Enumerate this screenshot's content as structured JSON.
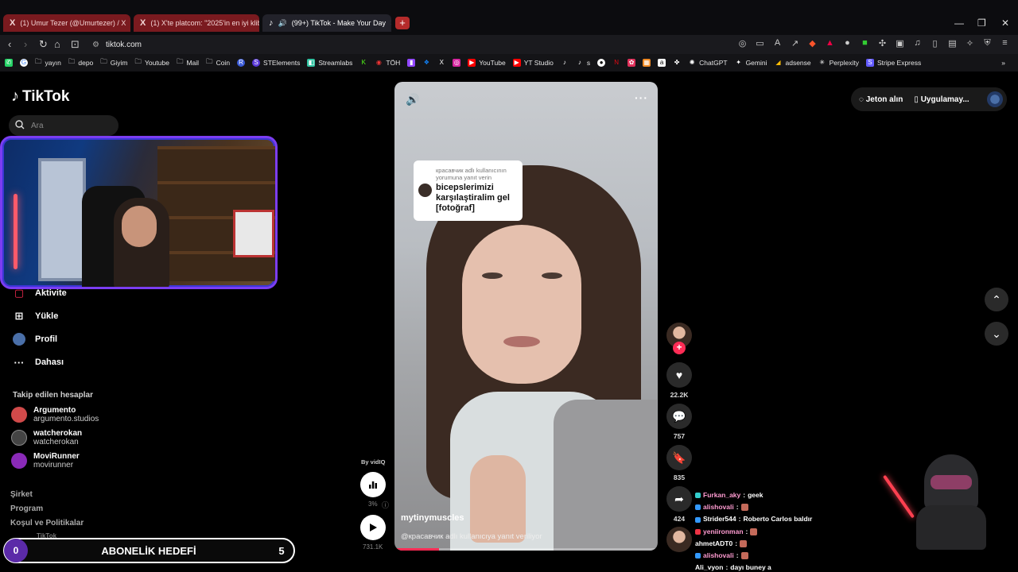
{
  "browser": {
    "tabs": [
      {
        "title": "(1) Umur Tezer (@Umurtezer) / X",
        "logo": "X"
      },
      {
        "title": "(1) X'te platcom: \"2025'in en iyi klibi",
        "logo": "X"
      },
      {
        "title": "(99+) TikTok - Make Your Day",
        "logo": "♪"
      }
    ],
    "new_tab": "+",
    "url": "tiktok.com",
    "bookmarks": [
      "yayın",
      "depo",
      "Giyim",
      "Youtube",
      "Mail",
      "Coin",
      "STElements",
      "Streamlabs",
      "TÖH",
      "YouTube",
      "YT Studio",
      "s",
      "ChatGPT",
      "Gemini",
      "adsense",
      "Perplexity",
      "Stripe Express"
    ]
  },
  "sidebar": {
    "brand": "TikTok",
    "search_placeholder": "Ara",
    "items": [
      {
        "label": "Aktivite"
      },
      {
        "label": "Yükle"
      },
      {
        "label": "Profil"
      },
      {
        "label": "Dahası"
      }
    ],
    "following_title": "Takip edilen hesaplar",
    "following": [
      {
        "name": "Argumento",
        "handle": "argumento.studios",
        "color": "#d04a4a"
      },
      {
        "name": "watcherokan",
        "handle": "watcherokan",
        "color": "#444444"
      },
      {
        "name": "MoviRunner",
        "handle": "movirunner",
        "color": "#8a2ab8"
      }
    ],
    "footer": [
      "Şirket",
      "Program",
      "Koşul ve Politikalar"
    ],
    "footer_tiktok": "TikTok"
  },
  "goal": {
    "current": "0",
    "label": "ABONELİK HEDEFİ",
    "target": "5"
  },
  "video": {
    "reply_sub": "красавчик adlı kullanıcının yorumuna yanıt verin",
    "reply_main": "bicepslerimizi karşılaştiralim gel [fotoğraf]",
    "author": "mytinymuscles",
    "description": "@красавчик adlı kullanıcıya yanıt veriliyor",
    "progress": 0.17
  },
  "vidiq": {
    "by": "By vidIQ",
    "percent": "3%",
    "views": "731.1K"
  },
  "actions": {
    "likes": "22.2K",
    "comments": "757",
    "saves": "835",
    "shares": "424"
  },
  "top_actions": {
    "coins": "Jeton alın",
    "app": "Uygulamay..."
  },
  "chat": [
    {
      "user": "Furkan_aky",
      "msg": "geek",
      "color": "#ff9bd1",
      "emote": false
    },
    {
      "user": "alishovali",
      "msg": "",
      "color": "#ff9bd1",
      "emote": true
    },
    {
      "user": "Strider544",
      "msg": "Roberto Carlos baldır",
      "color": "#ffffff",
      "emote": false
    },
    {
      "user": "yeniironman",
      "msg": "",
      "color": "#ff9bd1",
      "emote": true
    },
    {
      "user": "ahmetADT0",
      "msg": "",
      "color": "#ffffff",
      "emote": true
    },
    {
      "user": "alishovali",
      "msg": "",
      "color": "#ff9bd1",
      "emote": true
    },
    {
      "user": "Ali_vyon",
      "msg": "dayı buney a",
      "color": "#ffffff",
      "emote": false
    }
  ],
  "colors": {
    "accent": "#fe2c55",
    "webcam_border": "#7b3df2",
    "goal_fill": "#5b2aa8"
  }
}
